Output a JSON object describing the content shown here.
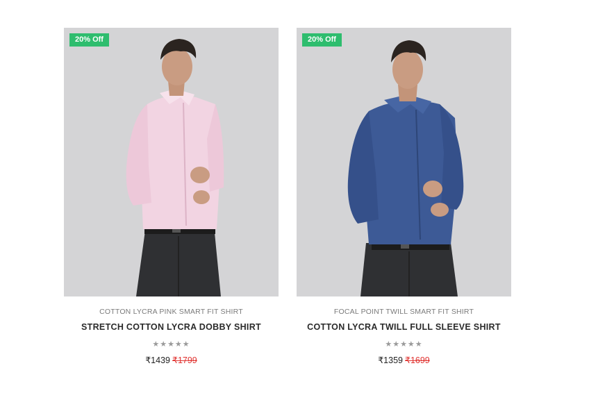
{
  "products": [
    {
      "badge": "20% Off",
      "subtitle": "COTTON LYCRA PINK SMART FIT SHIRT",
      "title": "STRETCH COTTON LYCRA DOBBY SHIRT",
      "stars": "★★★★★",
      "rating": 0,
      "price": "₹1439",
      "old_price": "₹1799",
      "shirt_color": "#f2d4e2",
      "image": "model-pink-shirt-photo"
    },
    {
      "badge": "20% Off",
      "subtitle": "FOCAL POINT TWILL SMART FIT SHIRT",
      "title": "COTTON LYCRA TWILL FULL SLEEVE SHIRT",
      "stars": "★★★★★",
      "rating": 0,
      "price": "₹1359",
      "old_price": "₹1699",
      "shirt_color": "#3d5a96",
      "image": "model-blue-shirt-photo"
    }
  ],
  "colors": {
    "badge": "#2ebd6e",
    "old_price": "#e0322f",
    "image_background": "#d4d4d6"
  }
}
